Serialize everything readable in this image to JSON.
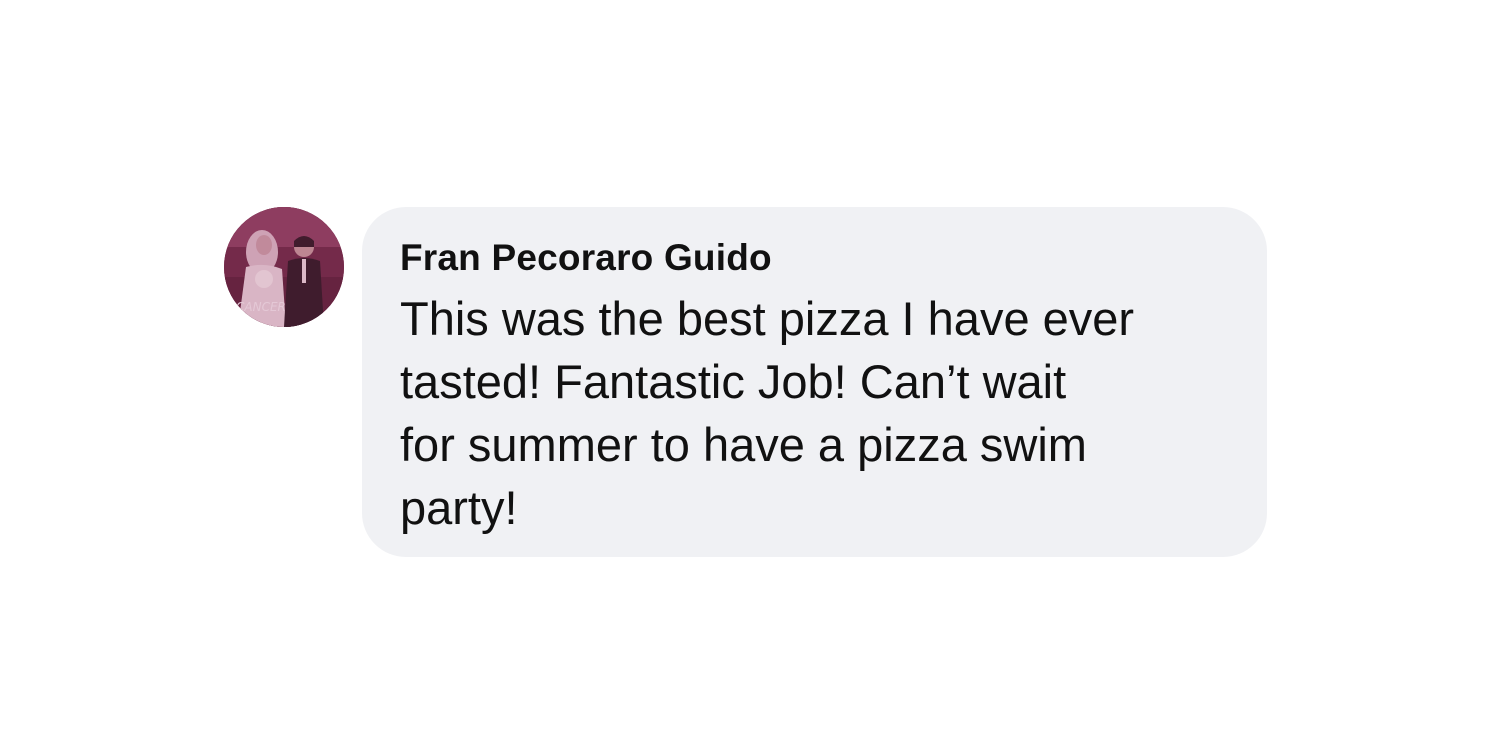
{
  "comment": {
    "author": "Fran Pecoraro Guido",
    "text": "This was the best pizza I have ever\ntasted! Fantastic Job! Can’t wait\nfor summer to have a pizza swim\nparty!",
    "avatar_overlay_text": "CANCER"
  },
  "colors": {
    "bubble_background": "#f0f1f4",
    "text": "#111111",
    "avatar_tint": "#7a2e4c"
  }
}
